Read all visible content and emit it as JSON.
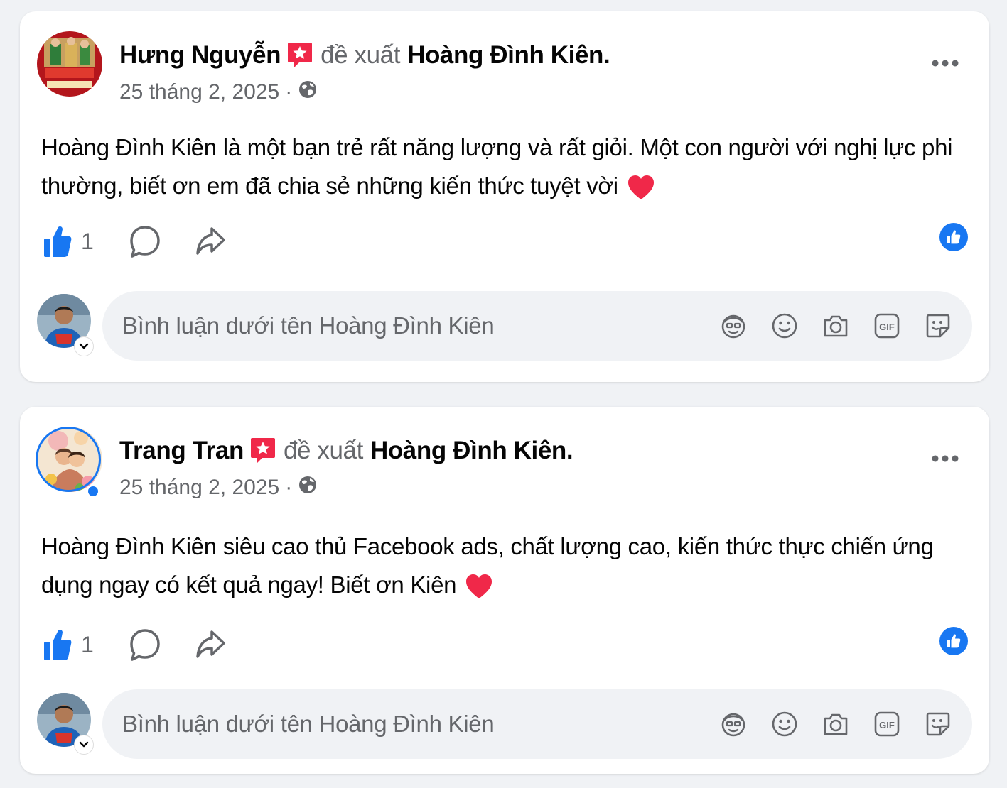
{
  "posts": [
    {
      "author": "Hưng Nguyễn",
      "verb": "đề xuất",
      "target": "Hoàng Đình Kiên.",
      "date": "25 tháng 2, 2025",
      "separator": "·",
      "text": "Hoàng Đình Kiên là một bạn trẻ rất năng lượng và rất giỏi. Một con người với nghị lực phi thường, biết ơn em đã chia sẻ những kiến thức tuyệt vời",
      "likes": "1",
      "comment_placeholder": "Bình luận dưới tên Hoàng Đình Kiên"
    },
    {
      "author": "Trang Tran",
      "verb": "đề xuất",
      "target": "Hoàng Đình Kiên.",
      "date": "25 tháng 2, 2025",
      "separator": "·",
      "text": "Hoàng Đình Kiên siêu cao thủ Facebook ads, chất lượng cao, kiến thức thực chiến ứng dụng ngay có kết quả ngay! Biết ơn Kiên",
      "likes": "1",
      "comment_placeholder": "Bình luận dưới tên Hoàng Đình Kiên"
    }
  ],
  "icons": {
    "recommend_badge": "recommend-star-icon",
    "audience": "globe-icon",
    "more": "more-dots-icon",
    "like": "thumbs-up-icon",
    "comment": "comment-bubble-icon",
    "share": "share-arrow-icon",
    "avatar_sticker": "avatar-sticker-icon",
    "emoji": "smiley-icon",
    "camera": "camera-icon",
    "gif": "gif-icon",
    "sticker": "sticker-icon",
    "heart": "red-heart-icon"
  },
  "colors": {
    "accent": "#1877f2",
    "badge_red": "#f02849",
    "secondary_text": "#65676b",
    "input_bg": "#f0f2f5"
  }
}
